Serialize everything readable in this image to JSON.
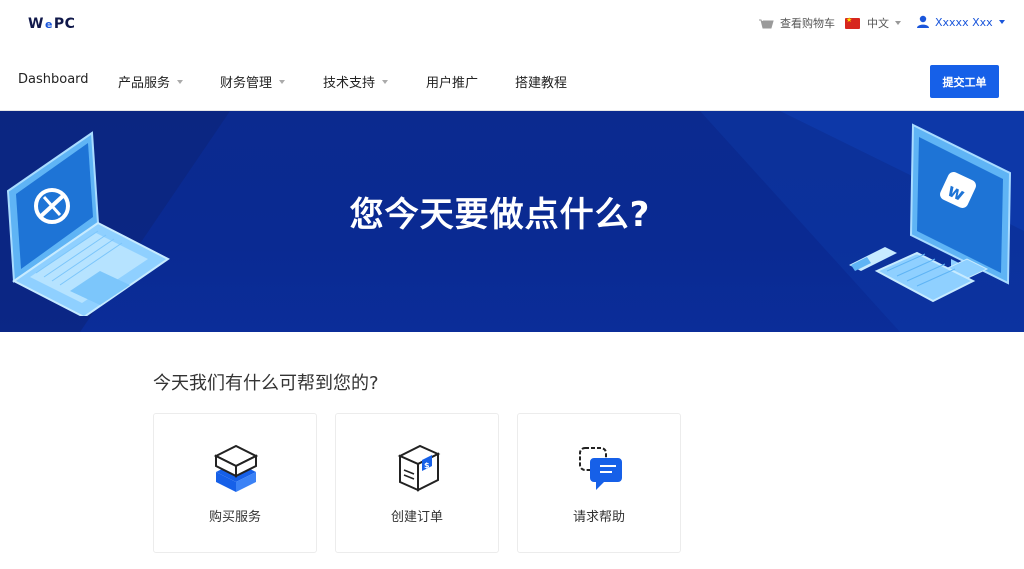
{
  "brand": {
    "logo_w": "W",
    "logo_e": "e",
    "logo_pc": "PC"
  },
  "header": {
    "cart_label": "查看购物车",
    "language_label": "中文",
    "user_name": "Xxxxx Xxx"
  },
  "nav": {
    "items": [
      {
        "label": "Dashboard",
        "has_dropdown": false
      },
      {
        "label": "产品服务",
        "has_dropdown": true
      },
      {
        "label": "财务管理",
        "has_dropdown": true
      },
      {
        "label": "技术支持",
        "has_dropdown": true
      },
      {
        "label": "用户推广",
        "has_dropdown": false
      },
      {
        "label": "搭建教程",
        "has_dropdown": false
      }
    ],
    "submit_ticket_label": "提交工单"
  },
  "banner": {
    "title": "您今天要做点什么?"
  },
  "help": {
    "title": "今天我们有什么可帮到您的?",
    "cards": [
      {
        "label": "购买服务",
        "icon": "server-box-icon"
      },
      {
        "label": "创建订单",
        "icon": "package-box-icon"
      },
      {
        "label": "请求帮助",
        "icon": "chat-bubbles-icon"
      }
    ]
  },
  "colors": {
    "accent": "#1660e8",
    "banner": "#0a2a92",
    "user_link": "#1a56db"
  }
}
